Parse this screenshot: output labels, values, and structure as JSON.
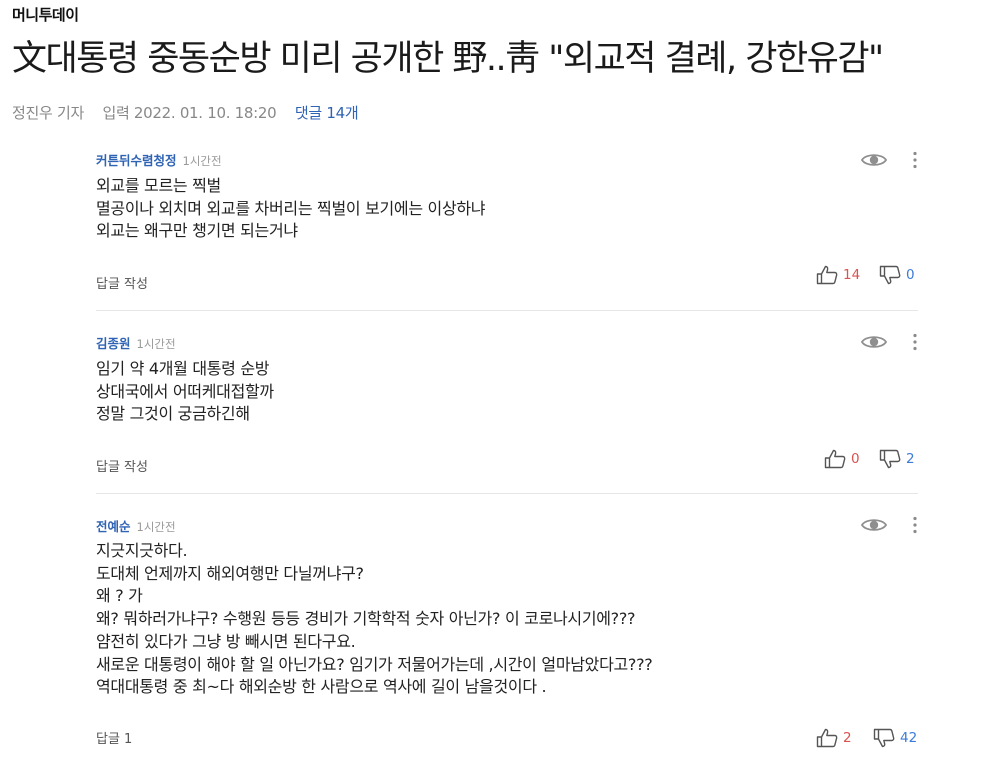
{
  "source": "머니투데이",
  "headline": "文대통령 중동순방 미리 공개한 野..靑 \"외교적 결례, 강한유감\"",
  "meta": {
    "reporter": "정진우 기자",
    "date": "입력 2022. 01. 10. 18:20",
    "comments_link": "댓글 14개"
  },
  "colors": {
    "author": "#2f63b4",
    "like": "#d9534f",
    "dislike": "#3d7bd9",
    "divider": "#e6e6e6"
  },
  "icons": [
    "eye-icon",
    "more-vertical-icon",
    "thumbs-up-icon",
    "thumbs-down-icon"
  ],
  "comments": [
    {
      "author": "커튼뒤수렴청정",
      "time": "1시간전",
      "lines": [
        "외교를 모르는 찍벌",
        "멸공이나 외치며 외교를 차버리는 찍벌이 보기에는 이상하냐",
        "외교는 왜구만 챙기면 되는거냐"
      ],
      "reply": "답글 작성",
      "likes": "14",
      "dislikes": "0"
    },
    {
      "author": "김종원",
      "time": "1시간전",
      "lines": [
        "임기 약 4개월 대통령 순방",
        "상대국에서 어떠케대접할까",
        "정말  그것이 궁금하긴해"
      ],
      "reply": "답글 작성",
      "likes": "0",
      "dislikes": "2"
    },
    {
      "author": "전예순",
      "time": "1시간전",
      "lines": [
        "지긋지긋하다.",
        "도대체 언제까지 해외여행만 다닐꺼냐구?",
        "왜 ? 가",
        "왜? 뭐하러가냐구?  수행원 등등 경비가 기학학적 숫자 아닌가? 이 코로나시기에???",
        "얌전히 있다가 그냥 방 빼시면 된다구요.",
        "새로운 대통령이 해야  할 일 아닌가요?  임기가 저물어가는데 ,시간이 얼마남았다고???",
        "역대대통령 중 최~다 해외순방 한 사람으로 역사에 길이 남을것이다 ."
      ],
      "reply": "답글 1",
      "likes": "2",
      "dislikes": "42"
    }
  ]
}
